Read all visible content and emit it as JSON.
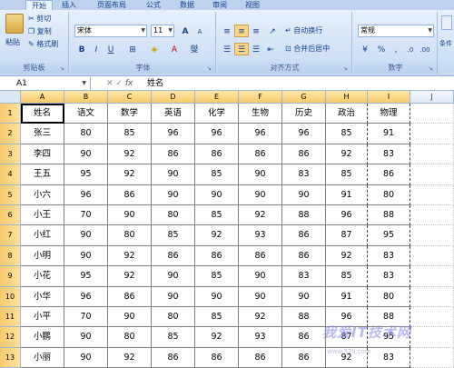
{
  "tabs": [
    "开始",
    "插入",
    "页面布局",
    "公式",
    "数据",
    "审阅",
    "视图"
  ],
  "clipboard": {
    "paste": "粘贴",
    "cut": "剪切",
    "copy": "复制",
    "format_painter": "格式刷",
    "label": "剪贴板"
  },
  "font": {
    "name": "宋体",
    "size": "11",
    "label": "字体"
  },
  "alignment": {
    "wrap": "自动换行",
    "merge": "合并后居中",
    "label": "对齐方式"
  },
  "number": {
    "format": "常规",
    "label": "数字",
    "extra": "条件"
  },
  "formula_bar": {
    "cell_ref": "A1",
    "fx": "fx",
    "content": "姓名"
  },
  "columns": [
    "A",
    "B",
    "C",
    "D",
    "E",
    "F",
    "G",
    "H",
    "I",
    "J"
  ],
  "rows": [
    "1",
    "2",
    "3",
    "4",
    "5",
    "6",
    "7",
    "8",
    "9",
    "10",
    "11",
    "12",
    "13"
  ],
  "table": [
    [
      "姓名",
      "语文",
      "数学",
      "英语",
      "化学",
      "生物",
      "历史",
      "政治",
      "物理"
    ],
    [
      "张三",
      "80",
      "85",
      "96",
      "96",
      "96",
      "96",
      "85",
      "91"
    ],
    [
      "李四",
      "90",
      "92",
      "86",
      "86",
      "86",
      "86",
      "92",
      "83"
    ],
    [
      "王五",
      "95",
      "92",
      "90",
      "85",
      "90",
      "83",
      "85",
      "86"
    ],
    [
      "小六",
      "96",
      "86",
      "90",
      "90",
      "90",
      "90",
      "91",
      "80"
    ],
    [
      "小王",
      "70",
      "90",
      "80",
      "85",
      "92",
      "88",
      "96",
      "88"
    ],
    [
      "小红",
      "90",
      "80",
      "85",
      "92",
      "93",
      "86",
      "87",
      "95"
    ],
    [
      "小明",
      "90",
      "92",
      "86",
      "86",
      "86",
      "86",
      "92",
      "83"
    ],
    [
      "小花",
      "95",
      "92",
      "90",
      "85",
      "90",
      "83",
      "85",
      "83"
    ],
    [
      "小华",
      "96",
      "86",
      "90",
      "90",
      "90",
      "90",
      "91",
      "80"
    ],
    [
      "小平",
      "70",
      "90",
      "80",
      "85",
      "92",
      "88",
      "96",
      "88"
    ],
    [
      "小鹏",
      "90",
      "80",
      "85",
      "92",
      "93",
      "86",
      "87",
      "95"
    ],
    [
      "小丽",
      "90",
      "92",
      "86",
      "86",
      "86",
      "86",
      "92",
      "83"
    ]
  ],
  "watermark": {
    "main": "我爱IT技术网",
    "sub": "www.52ij.com"
  }
}
